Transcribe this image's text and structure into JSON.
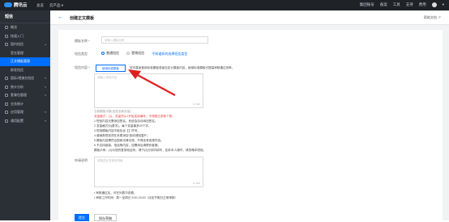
{
  "topbar": {
    "brand": "腾讯云",
    "nav": [
      "总览",
      "云产品 ▾"
    ],
    "right": [
      "集团账号",
      "备案",
      "工具",
      "支持",
      "费用",
      "▾"
    ]
  },
  "sidebar": {
    "title": "短信",
    "items": [
      {
        "label": "概览",
        "icon": "dashboard-icon"
      },
      {
        "label": "快速入门",
        "icon": "rocket-icon"
      },
      {
        "label": "国内短信",
        "icon": "message-icon",
        "chev": "▴"
      },
      {
        "label": "签名管理",
        "sub": true
      },
      {
        "label": "正文模板管理",
        "sub": true,
        "active": true
      },
      {
        "label": "群发短信",
        "sub": true
      },
      {
        "label": "国际/港澳台短信",
        "icon": "globe-icon",
        "chev": "▾"
      },
      {
        "label": "统计分析",
        "icon": "chart-icon",
        "chev": "▾"
      },
      {
        "label": "套餐包管理",
        "icon": "package-icon",
        "chev": "▾"
      },
      {
        "label": "业务统计",
        "icon": "stats-icon"
      },
      {
        "label": "应用管理",
        "icon": "app-icon",
        "chev": "▾"
      },
      {
        "label": "通用配置",
        "icon": "settings-icon",
        "chev": "▾"
      }
    ]
  },
  "header": {
    "back": "←",
    "title": "创建正文模板",
    "help": "帮助文档 ↗"
  },
  "form": {
    "name_label": "模板名称 *",
    "name_placeholder": "请输入模板名称",
    "type_label": "短信类型",
    "type_options": [
      "普通短信",
      "营销短信"
    ],
    "type_link": "不知道如何选择短信类型",
    "content_label": "短信内容 *",
    "use_template_button": "使用标准模板",
    "content_hint": "您可直接使用标准模板或者自定义模板内容，使用标准模板可提高审核通过效率。",
    "content_placeholder": "请输入短信内容",
    "content_count": "0 / 500",
    "notes": [
      "当前模板字数(含签名和变量)",
      "变量格式：{1}，变量须从1开始连续编号，不得超过参数个数。",
      "1 短信内容无需添加签名，系统会自动添加签名。",
      "2 变量格式为{数字}，每个变量最多20个字。",
      "3 短信模板内容不能包含【】符号。",
      "4 营销类短信须在末尾添加“拒收请回复R”。",
      "5 模板内容需符合国家法律法规，不得含有违规内容。",
      "6 不支持链接、电话等内容，如需添加请联系客服。",
      "模板示例：{1}为您的登录验证码，请于{2}分钟内填写，如非本人操作，请忽略本短信。"
    ],
    "remark_label": "申请说明",
    "remark_placeholder": "请描述业务使用场景",
    "remark_count": "0 / 500",
    "tips": [
      "• 审核通过后，可在列表中查看。",
      "• 审核工作时间：周一至周日 9:00-23:00（法定节假日正常审核）"
    ]
  },
  "buttons": {
    "submit": "提交",
    "save": "保存草稿"
  }
}
